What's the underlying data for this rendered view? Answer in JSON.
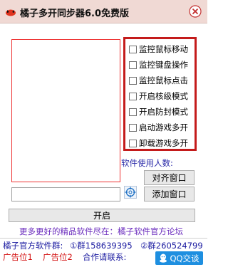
{
  "window": {
    "title": "橘子多开同步器6.0免费版",
    "close_icon": "close-icon",
    "app_icon": "orange-app-icon"
  },
  "options": [
    {
      "label": "监控鼠标移动",
      "checked": false
    },
    {
      "label": "监控键盘操作",
      "checked": false
    },
    {
      "label": "监控鼠标点击",
      "checked": false
    },
    {
      "label": "开启核级模式",
      "checked": false
    },
    {
      "label": "开启防封模式",
      "checked": false
    },
    {
      "label": "启动游戏多开",
      "checked": false
    },
    {
      "label": "卸载游戏多开",
      "checked": false
    }
  ],
  "count": {
    "label": "软件使用人数:",
    "value": ""
  },
  "buttons": {
    "align": "对齐窗口",
    "add": "添加窗口",
    "start": "开启"
  },
  "footer": {
    "promo": "更多更好的精品软件尽在：橘子软件官方论坛",
    "group_label": "橘子官方软件群:",
    "group1": "①群158639395",
    "group2": "②群260524799",
    "ad1": "广告位1",
    "ad2": "广告位2",
    "contact": "合作请联系:",
    "qq": "QQ交谈"
  },
  "colors": {
    "accent_red": "#c41b1b",
    "link_blue": "#1a1aa0",
    "promo_purple": "#6a2bbd",
    "qq_blue": "#1e8fe0"
  }
}
